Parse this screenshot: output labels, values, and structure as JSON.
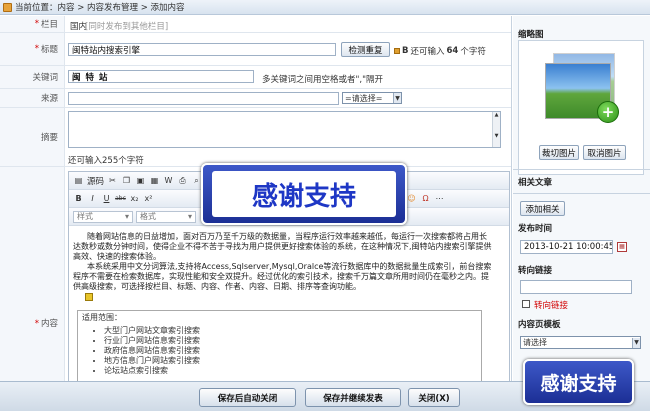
{
  "breadcrumb": {
    "text": "当前位置：内容 > 内容发布管理 > 添加内容"
  },
  "form": {
    "column": {
      "label": "栏目",
      "value": "国内",
      "link": "[同时发布到其他栏目]"
    },
    "title": {
      "label": "标题",
      "value": "闽特站内搜索引擎",
      "check_button": "检测重复",
      "bold_icon": "B",
      "remaining_prefix": "还可输入",
      "remaining_count": "64",
      "remaining_suffix": "个字符"
    },
    "keywords": {
      "label": "关键词",
      "value": "闽 特 站",
      "hint": "多关键词之间用空格或者\",\"隔开"
    },
    "source": {
      "label": "来源",
      "select": "=请选择="
    },
    "summary": {
      "label": "摘要",
      "remaining_prefix": "还可输入",
      "remaining_count": "255",
      "remaining_suffix": "个字符"
    },
    "content_label": "内容"
  },
  "editor": {
    "toolbar1": {
      "source": "源码"
    },
    "toolbar2": [
      "B",
      "I",
      "U",
      "abc",
      "x₂",
      "x²"
    ],
    "style_select": "样式",
    "format_select": "格式",
    "paragraph1": "随着网站信息的日益增加，面对百万乃至千万级的数据量，当程序运行效率越来越低，每运行一次搜索都将占用长达数秒或数分钟时间，使得企业不得不苦于寻找为用户提供更好搜索体验的系统，在这种情况下,闽特站内搜索引擎提供高效、快速的搜索体验。",
    "paragraph2": "本系统采用中文分词算法,支持将Access,Sqlserver,Mysql,Oralce等流行数据库中的数据批量生成索引，前台搜索程序不需要在检索数据库，实现性能和安全双提升。经过优化的索引技术，搜索千万篇文章所用时间仍在毫秒之内。提供高级搜索，可选择按栏目、标题、内容、作者、内容、日期、排序等查询功能。",
    "table_title": "适用范围：",
    "scope_items": [
      "大型门户网站文章索引搜索",
      "行业门户网站信息索引搜索",
      "政府信息网站信息索引搜索",
      "地方信息门户网站索引搜索",
      "论坛站点索引搜索"
    ]
  },
  "sidebar": {
    "thumbnail_title": "缩略图",
    "crop_button": "裁切图片",
    "cancel_button": "取消图片",
    "related_title": "相关文章",
    "add_related_button": "添加相关",
    "publish_time_title": "发布时间",
    "publish_time": "2013-10-21 10:00:45",
    "redirect_title": "转向链接",
    "redirect_checkbox": "转向链接",
    "template_title": "内容页模板",
    "template_select": "请选择"
  },
  "buttons": {
    "save_close": "保存后自动关闭",
    "save_continue": "保存并继续发表",
    "close": "关闭(X)"
  },
  "watermark": {
    "text": "感谢支持"
  },
  "colors": {
    "required": "#d20000",
    "header_bg": "#d8e3ef",
    "watermark_blue": "#1e37c5"
  }
}
